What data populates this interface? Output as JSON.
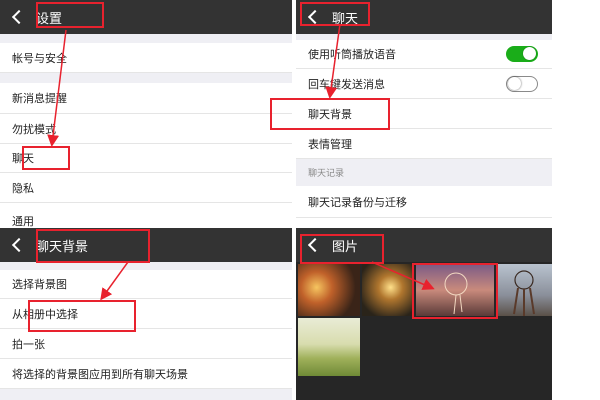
{
  "settings_panel": {
    "back_icon": "chevron-left-icon",
    "title": "设置",
    "items": [
      "帐号与安全",
      "新消息提醒",
      "勿扰模式",
      "聊天",
      "隐私",
      "通用"
    ]
  },
  "chat_panel": {
    "back_icon": "chevron-left-icon",
    "title": "聊天",
    "items": [
      {
        "label": "使用听筒播放语音",
        "toggle": "on"
      },
      {
        "label": "回车键发送消息",
        "toggle": "off"
      },
      {
        "label": "聊天背景"
      },
      {
        "label": "表情管理"
      }
    ],
    "section_header": "聊天记录",
    "backup_item": "聊天记录备份与迁移"
  },
  "chat_bg_panel": {
    "back_icon": "chevron-left-icon",
    "title": "聊天背景",
    "items": [
      "选择背景图",
      "从相册中选择",
      "拍一张",
      "将选择的背景图应用到所有聊天场景"
    ]
  },
  "photos_panel": {
    "back_icon": "chevron-left-icon",
    "title": "图片",
    "thumbnails": [
      "sunset-photo",
      "forest-light-photo",
      "dreamcatcher-sunset-photo",
      "dreamcatcher-sky-photo",
      "field-landscape-photo"
    ]
  },
  "colors": {
    "title_bar": "#333333",
    "toggle_on": "#1aad19",
    "toggle_off": "#8a8a8a",
    "highlight": "#e8222e"
  }
}
